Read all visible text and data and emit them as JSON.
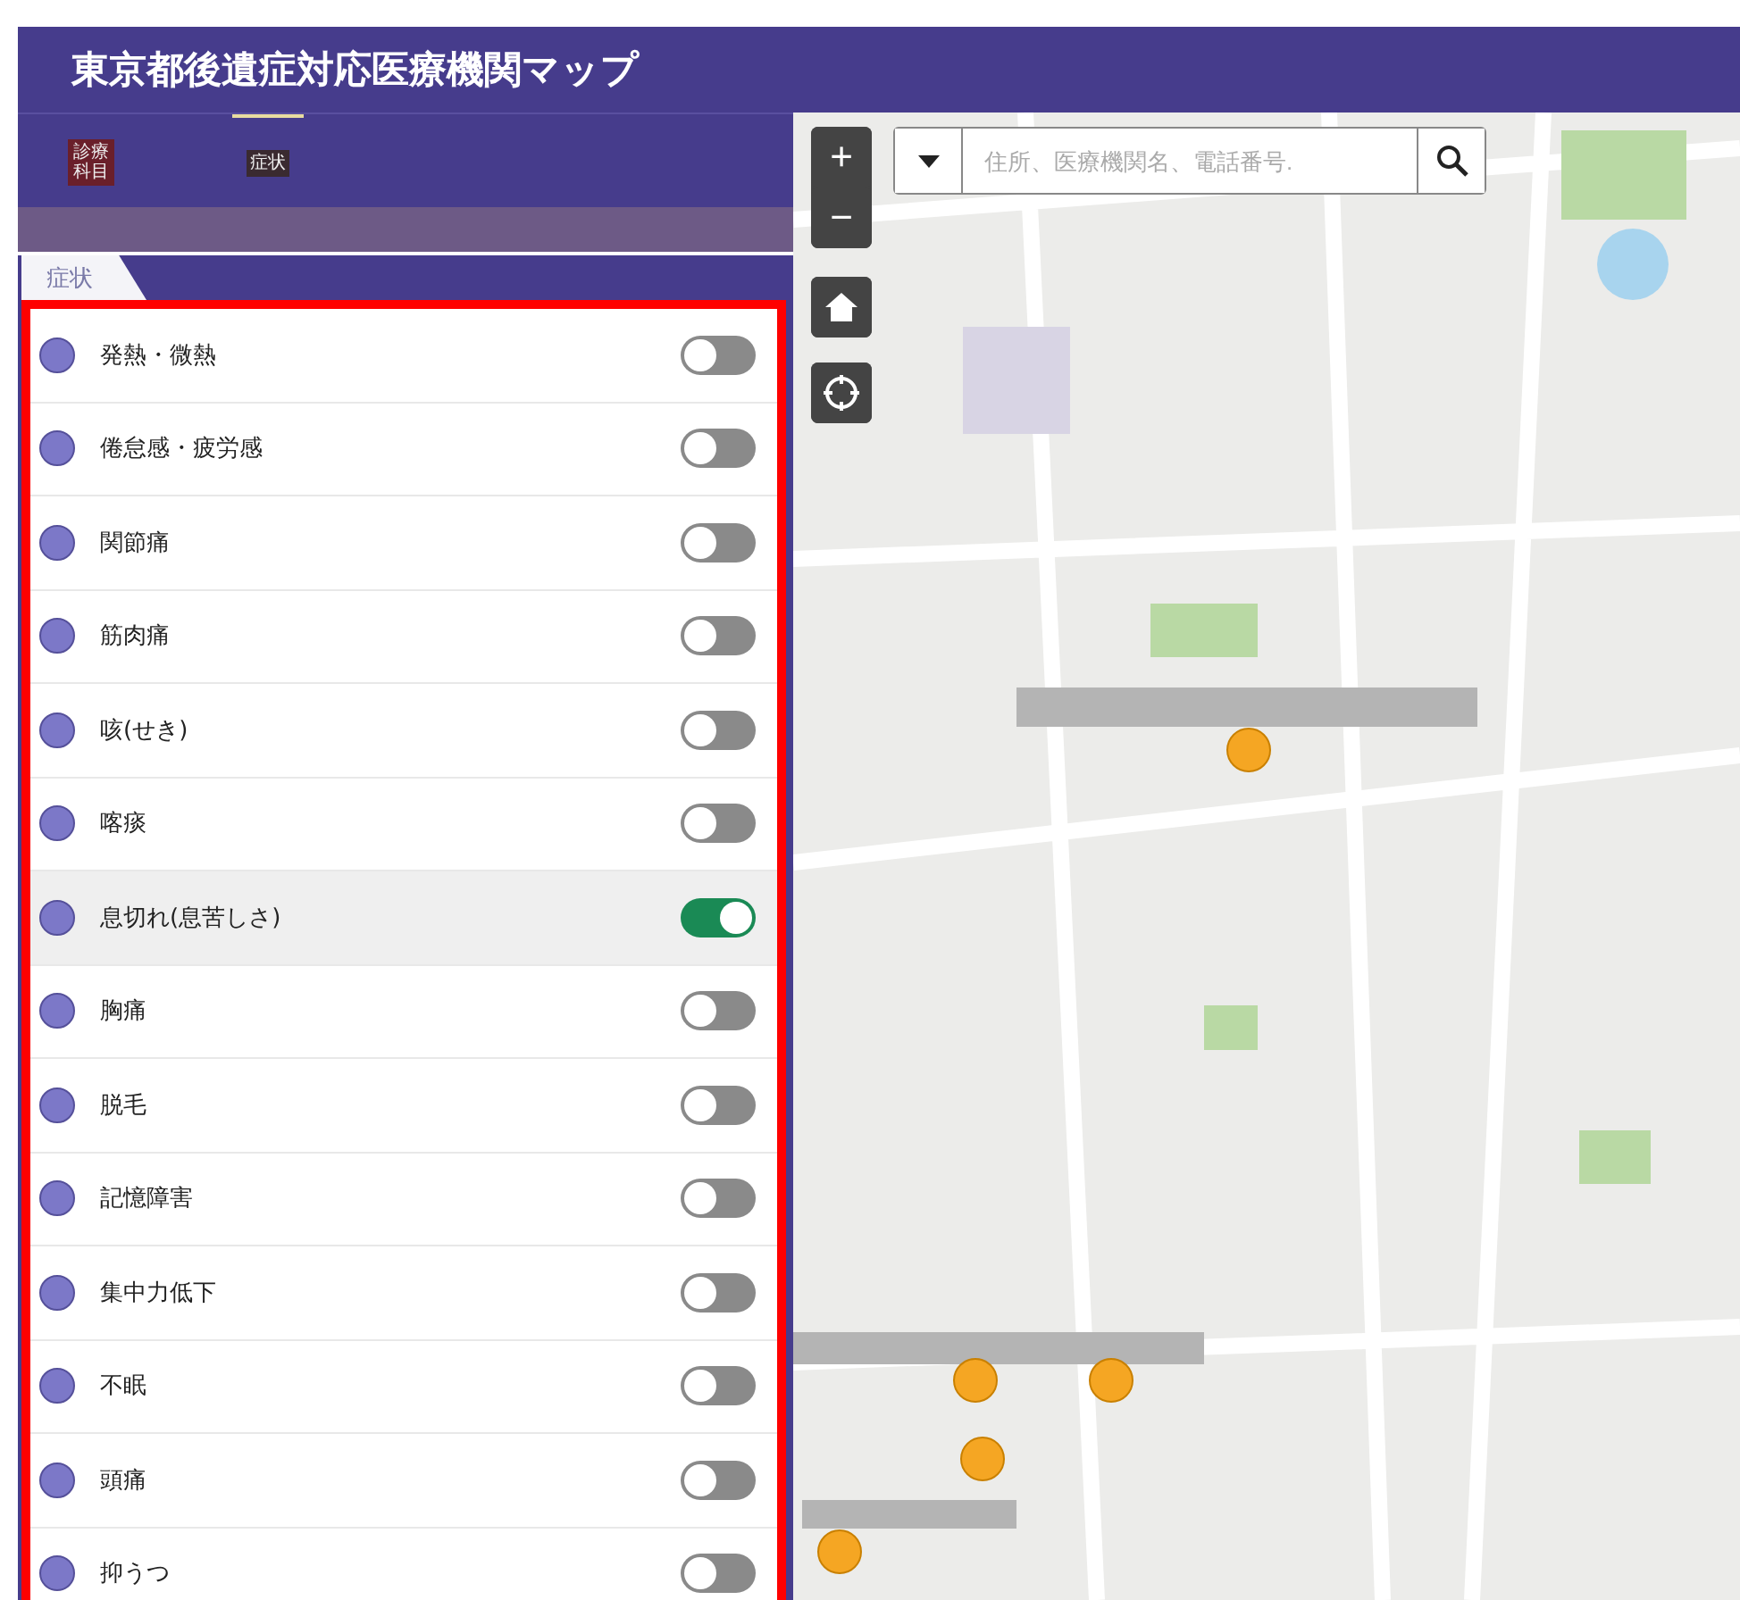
{
  "header": {
    "title": "東京都後遺症対応医療機関マップ"
  },
  "tabs": [
    {
      "label": "診療科目",
      "selected": false
    },
    {
      "label": "症状",
      "selected": true
    }
  ],
  "subtab": {
    "label": "症状"
  },
  "symptoms": [
    {
      "label": "発熱・微熱",
      "on": false
    },
    {
      "label": "倦怠感・疲労感",
      "on": false
    },
    {
      "label": "関節痛",
      "on": false
    },
    {
      "label": "筋肉痛",
      "on": false
    },
    {
      "label": "咳(せき)",
      "on": false
    },
    {
      "label": "喀痰",
      "on": false
    },
    {
      "label": "息切れ(息苦しさ)",
      "on": true
    },
    {
      "label": "胸痛",
      "on": false
    },
    {
      "label": "脱毛",
      "on": false
    },
    {
      "label": "記憶障害",
      "on": false
    },
    {
      "label": "集中力低下",
      "on": false
    },
    {
      "label": "不眠",
      "on": false
    },
    {
      "label": "頭痛",
      "on": false
    },
    {
      "label": "抑うつ",
      "on": false
    }
  ],
  "map": {
    "kind": "picture",
    "search": {
      "placeholder": "住所、医療機関名、電話番号."
    },
    "zoom_in": "+",
    "zoom_out": "−"
  }
}
